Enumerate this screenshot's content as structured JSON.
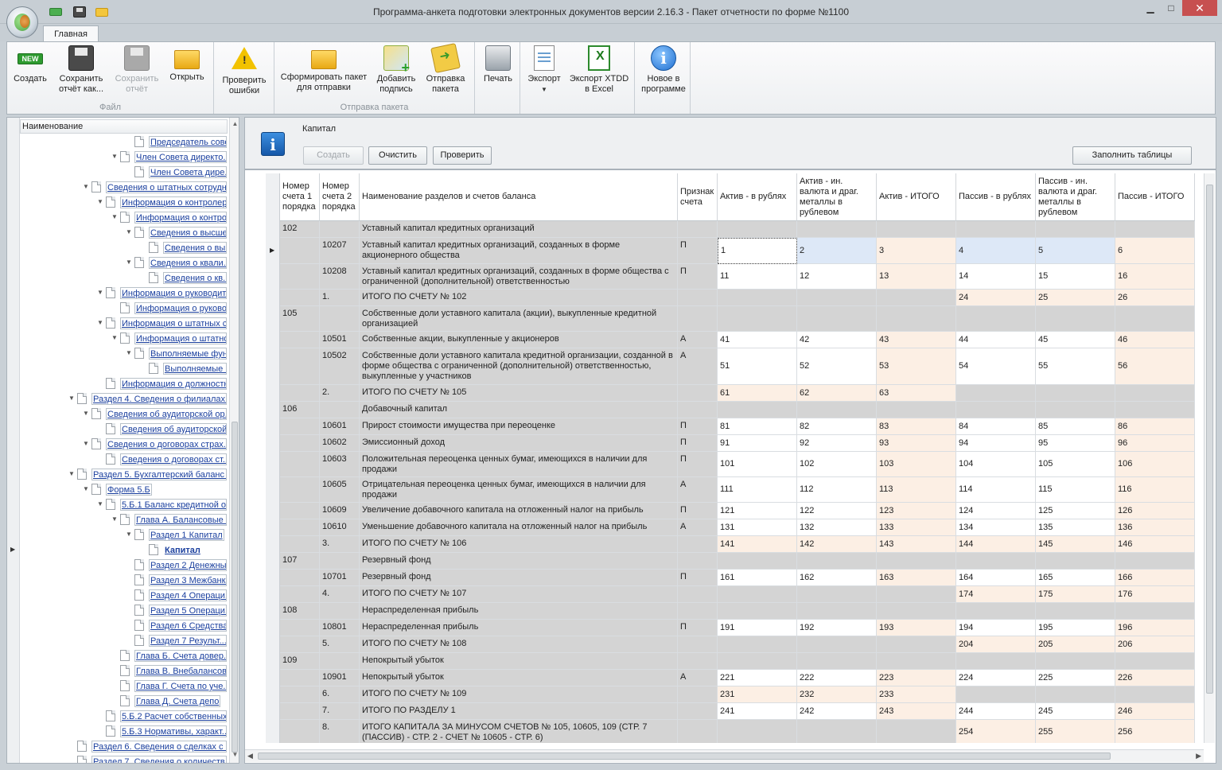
{
  "window": {
    "title": "Программа-анкета подготовки электронных документов версии 2.16.3 - Пакет отчетности по форме №1100",
    "min_icon": "minimize-icon",
    "max_icon": "maximize-icon",
    "close_icon": "close-icon"
  },
  "ribbon": {
    "tab": "Главная",
    "groups": [
      {
        "label": "Файл",
        "buttons": [
          {
            "id": "create",
            "label": "Создать",
            "icon": "new-icon"
          },
          {
            "id": "save_as",
            "label": "Сохранить\nотчёт как...",
            "icon": "floppy-icon"
          },
          {
            "id": "save",
            "label": "Сохранить\nотчёт",
            "icon": "floppy-icon",
            "disabled": true
          },
          {
            "id": "open",
            "label": "Открыть",
            "icon": "folder-icon"
          }
        ]
      },
      {
        "label": "",
        "buttons": [
          {
            "id": "check",
            "label": "Проверить\nошибки",
            "icon": "warning-icon"
          }
        ]
      },
      {
        "label": "Отправка пакета",
        "buttons": [
          {
            "id": "form_pkg",
            "label": "Сформировать пакет\nдля отправки",
            "icon": "folder-icon"
          },
          {
            "id": "sign",
            "label": "Добавить\nподпись",
            "icon": "add-signature-icon"
          },
          {
            "id": "send",
            "label": "Отправка\nпакета",
            "icon": "send-icon"
          }
        ]
      },
      {
        "label": "",
        "buttons": [
          {
            "id": "print",
            "label": "Печать",
            "icon": "printer-icon"
          }
        ]
      },
      {
        "label": "",
        "buttons": [
          {
            "id": "export",
            "label": "Экспорт",
            "icon": "export-icon"
          },
          {
            "id": "export_xtdd",
            "label": "Экспорт XTDD\nв Excel",
            "icon": "excel-icon"
          }
        ]
      },
      {
        "label": "",
        "buttons": [
          {
            "id": "whatsnew",
            "label": "Новое в\nпрограмме",
            "icon": "info-icon"
          }
        ]
      }
    ]
  },
  "tree": {
    "header": "Наименование",
    "items": [
      {
        "level": 7,
        "exp": "",
        "label": "Председатель совета ..."
      },
      {
        "level": 6,
        "exp": "▼",
        "label": "Член Совета директо..."
      },
      {
        "level": 7,
        "exp": "",
        "label": "Член Совета дире..."
      },
      {
        "level": 4,
        "exp": "▼",
        "label": "Сведения о штатных сотрудн..."
      },
      {
        "level": 5,
        "exp": "▼",
        "label": "Информация о контролер..."
      },
      {
        "level": 6,
        "exp": "▼",
        "label": "Информация о контро..."
      },
      {
        "level": 7,
        "exp": "▼",
        "label": "Сведения о высше..."
      },
      {
        "level": 8,
        "exp": "",
        "label": "Сведения о вы..."
      },
      {
        "level": 7,
        "exp": "▼",
        "label": "Сведения о квали..."
      },
      {
        "level": 8,
        "exp": "",
        "label": "Сведения о кв..."
      },
      {
        "level": 5,
        "exp": "▼",
        "label": "Информация о руководит..."
      },
      {
        "level": 6,
        "exp": "",
        "label": "Информация о руково..."
      },
      {
        "level": 5,
        "exp": "▼",
        "label": "Информация о штатных с..."
      },
      {
        "level": 6,
        "exp": "▼",
        "label": "Информация о штатно..."
      },
      {
        "level": 7,
        "exp": "▼",
        "label": "Выполняемые фун..."
      },
      {
        "level": 8,
        "exp": "",
        "label": "Выполняемые ..."
      },
      {
        "level": 5,
        "exp": "",
        "label": "Информация о должностн..."
      },
      {
        "level": 3,
        "exp": "▼",
        "label": "Раздел 4. Сведения о филиалах ..."
      },
      {
        "level": 4,
        "exp": "▼",
        "label": "Сведения об аудиторской ор..."
      },
      {
        "level": 5,
        "exp": "",
        "label": "Сведения об аудиторской..."
      },
      {
        "level": 4,
        "exp": "▼",
        "label": "Сведения о договорах страх..."
      },
      {
        "level": 5,
        "exp": "",
        "label": "Сведения о договорах ст..."
      },
      {
        "level": 3,
        "exp": "▼",
        "label": "Раздел 5. Бухгалтерский баланс ..."
      },
      {
        "level": 4,
        "exp": "▼",
        "label": "Форма 5.Б"
      },
      {
        "level": 5,
        "exp": "▼",
        "label": "5.Б.1 Баланс кредитной о..."
      },
      {
        "level": 6,
        "exp": "▼",
        "label": "Глава А. Балансовые ..."
      },
      {
        "level": 7,
        "exp": "▼",
        "label": "Раздел 1 Капитал"
      },
      {
        "level": 8,
        "exp": "",
        "label": "Капитал",
        "current": true
      },
      {
        "level": 7,
        "exp": "",
        "label": "Раздел 2 Денежны..."
      },
      {
        "level": 7,
        "exp": "",
        "label": "Раздел 3 Межбанк..."
      },
      {
        "level": 7,
        "exp": "",
        "label": "Раздел 4 Операци..."
      },
      {
        "level": 7,
        "exp": "",
        "label": "Раздел 5 Операци..."
      },
      {
        "level": 7,
        "exp": "",
        "label": "Раздел 6 Средства..."
      },
      {
        "level": 7,
        "exp": "",
        "label": "Раздел 7 Результ..."
      },
      {
        "level": 6,
        "exp": "",
        "label": "Глава Б. Счета довер..."
      },
      {
        "level": 6,
        "exp": "",
        "label": "Глава В. Внебалансов..."
      },
      {
        "level": 6,
        "exp": "",
        "label": "Глава Г. Счета по уче..."
      },
      {
        "level": 6,
        "exp": "",
        "label": "Глава Д. Счета депо"
      },
      {
        "level": 5,
        "exp": "",
        "label": "5.Б.2 Расчет собственных..."
      },
      {
        "level": 5,
        "exp": "",
        "label": "5.Б.3 Нормативы, характ..."
      },
      {
        "level": 3,
        "exp": "",
        "label": "Раздел 6. Сведения о сделках с ..."
      },
      {
        "level": 3,
        "exp": "",
        "label": "Раздел 7. Сведения о количеств..."
      }
    ]
  },
  "form": {
    "title": "Капитал",
    "icon": "info-icon",
    "buttons": {
      "create": "Создать",
      "clear": "Очистить",
      "check": "Проверить",
      "fill": "Заполнить таблицы"
    }
  },
  "grid": {
    "columns": [
      "Номер счета 1 порядка",
      "Номер счета 2 порядка",
      "Наименование разделов и счетов баланса",
      "Признак счета",
      "Актив - в рублях",
      "Актив - ин. валюта и драг. металлы в рублевом",
      "Актив - ИТОГО",
      "Пассив - в рублях",
      "Пассив - ин. валюта и драг. металлы в рублевом",
      "Пассив - ИТОГО"
    ],
    "rows": [
      {
        "h": 21,
        "type": "group",
        "c1": "102",
        "c2": "",
        "name": "Уставный капитал кредитных организаций",
        "sign": "",
        "v": [
          "",
          "",
          "",
          "",
          "",
          ""
        ]
      },
      {
        "h": 33,
        "type": "data",
        "c1": "",
        "c2": "10207",
        "name": "Уставный капитал кредитных организаций, созданных в форме акционерного общества",
        "sign": "П",
        "v": [
          "1",
          "2",
          "3",
          "4",
          "5",
          "6"
        ],
        "selected": true
      },
      {
        "h": 32,
        "type": "data",
        "c1": "",
        "c2": "10208",
        "name": "Уставный капитал кредитных организаций, созданных в форме общества с ограниченной (дополнительной) ответственностью",
        "sign": "П",
        "v": [
          "11",
          "12",
          "13",
          "14",
          "15",
          "16"
        ]
      },
      {
        "h": 21,
        "type": "total_p",
        "c1": "",
        "c2": "1.",
        "name": "ИТОГО ПО СЧЕТУ № 102",
        "sign": "",
        "v": [
          "",
          "",
          "",
          "24",
          "25",
          "26"
        ]
      },
      {
        "h": 32,
        "type": "group",
        "c1": "105",
        "c2": "",
        "name": "Собственные доли уставного капитала (акции), выкупленные кредитной организацией",
        "sign": "",
        "v": [
          "",
          "",
          "",
          "",
          "",
          ""
        ]
      },
      {
        "h": 21,
        "type": "data",
        "c1": "",
        "c2": "10501",
        "name": "Собственные акции, выкупленные у акционеров",
        "sign": "А",
        "v": [
          "41",
          "42",
          "43",
          "44",
          "45",
          "46"
        ]
      },
      {
        "h": 46,
        "type": "data",
        "c1": "",
        "c2": "10502",
        "name": "Собственные доли уставного капитала кредитной организации, созданной в форме общества с ограниченной (дополнительной) ответственностью, выкупленные у участников",
        "sign": "А",
        "v": [
          "51",
          "52",
          "53",
          "54",
          "55",
          "56"
        ]
      },
      {
        "h": 21,
        "type": "total_a",
        "c1": "",
        "c2": "2.",
        "name": "ИТОГО ПО СЧЕТУ № 105",
        "sign": "",
        "v": [
          "61",
          "62",
          "63",
          "",
          "",
          ""
        ]
      },
      {
        "h": 21,
        "type": "group",
        "c1": "106",
        "c2": "",
        "name": "Добавочный капитал",
        "sign": "",
        "v": [
          "",
          "",
          "",
          "",
          "",
          ""
        ]
      },
      {
        "h": 21,
        "type": "data",
        "c1": "",
        "c2": "10601",
        "name": "Прирост стоимости имущества при переоценке",
        "sign": "П",
        "v": [
          "81",
          "82",
          "83",
          "84",
          "85",
          "86"
        ]
      },
      {
        "h": 21,
        "type": "data",
        "c1": "",
        "c2": "10602",
        "name": "Эмиссионный доход",
        "sign": "П",
        "v": [
          "91",
          "92",
          "93",
          "94",
          "95",
          "96"
        ]
      },
      {
        "h": 32,
        "type": "data",
        "c1": "",
        "c2": "10603",
        "name": "Положительная переоценка ценных бумаг, имеющихся в наличии для продажи",
        "sign": "П",
        "v": [
          "101",
          "102",
          "103",
          "104",
          "105",
          "106"
        ]
      },
      {
        "h": 32,
        "type": "data",
        "c1": "",
        "c2": "10605",
        "name": "Отрицательная переоценка ценных бумаг, имеющихся в наличии для продажи",
        "sign": "А",
        "v": [
          "111",
          "112",
          "113",
          "114",
          "115",
          "116"
        ]
      },
      {
        "h": 21,
        "type": "data",
        "c1": "",
        "c2": "10609",
        "name": "Увеличение добавочного капитала на отложенный налог на прибыль",
        "sign": "П",
        "v": [
          "121",
          "122",
          "123",
          "124",
          "125",
          "126"
        ]
      },
      {
        "h": 21,
        "type": "data",
        "c1": "",
        "c2": "10610",
        "name": "Уменьшение добавочного капитала на отложенный налог на прибыль",
        "sign": "А",
        "v": [
          "131",
          "132",
          "133",
          "134",
          "135",
          "136"
        ]
      },
      {
        "h": 21,
        "type": "total_all",
        "c1": "",
        "c2": "3.",
        "name": "ИТОГО ПО СЧЕТУ № 106",
        "sign": "",
        "v": [
          "141",
          "142",
          "143",
          "144",
          "145",
          "146"
        ]
      },
      {
        "h": 21,
        "type": "group",
        "c1": "107",
        "c2": "",
        "name": "Резервный фонд",
        "sign": "",
        "v": [
          "",
          "",
          "",
          "",
          "",
          ""
        ]
      },
      {
        "h": 21,
        "type": "data",
        "c1": "",
        "c2": "10701",
        "name": "Резервный фонд",
        "sign": "П",
        "v": [
          "161",
          "162",
          "163",
          "164",
          "165",
          "166"
        ]
      },
      {
        "h": 21,
        "type": "total_p",
        "c1": "",
        "c2": "4.",
        "name": "ИТОГО ПО СЧЕТУ № 107",
        "sign": "",
        "v": [
          "",
          "",
          "",
          "174",
          "175",
          "176"
        ]
      },
      {
        "h": 21,
        "type": "group",
        "c1": "108",
        "c2": "",
        "name": "Нераспределенная прибыль",
        "sign": "",
        "v": [
          "",
          "",
          "",
          "",
          "",
          ""
        ]
      },
      {
        "h": 21,
        "type": "data",
        "c1": "",
        "c2": "10801",
        "name": "Нераспределенная прибыль",
        "sign": "П",
        "v": [
          "191",
          "192",
          "193",
          "194",
          "195",
          "196"
        ]
      },
      {
        "h": 21,
        "type": "total_p",
        "c1": "",
        "c2": "5.",
        "name": "ИТОГО ПО СЧЕТУ № 108",
        "sign": "",
        "v": [
          "",
          "",
          "",
          "204",
          "205",
          "206"
        ]
      },
      {
        "h": 21,
        "type": "group",
        "c1": "109",
        "c2": "",
        "name": "Непокрытый убыток",
        "sign": "",
        "v": [
          "",
          "",
          "",
          "",
          "",
          ""
        ]
      },
      {
        "h": 21,
        "type": "data",
        "c1": "",
        "c2": "10901",
        "name": "Непокрытый убыток",
        "sign": "А",
        "v": [
          "221",
          "222",
          "223",
          "224",
          "225",
          "226"
        ]
      },
      {
        "h": 21,
        "type": "total_a",
        "c1": "",
        "c2": "6.",
        "name": " ИТОГО ПО СЧЕТУ № 109",
        "sign": "",
        "v": [
          "231",
          "232",
          "233",
          "",
          "",
          ""
        ]
      },
      {
        "h": 21,
        "type": "data_total",
        "c1": "",
        "c2": "7.",
        "name": "ИТОГО ПО РАЗДЕЛУ 1",
        "sign": "",
        "v": [
          "241",
          "242",
          "243",
          "244",
          "245",
          "246"
        ]
      },
      {
        "h": 32,
        "type": "total_p",
        "c1": "",
        "c2": "8.",
        "name": "ИТОГО КАПИТАЛА ЗА МИНУСОМ СЧЕТОВ № 105, 10605, 109 (СТР. 7 (ПАССИВ) - СТР. 2 - СЧЕТ № 10605 - СТР. 6)",
        "sign": "",
        "v": [
          "",
          "",
          "",
          "254",
          "255",
          "256"
        ]
      }
    ]
  },
  "colors": {
    "group_row": "#d4d4d4",
    "calc_cell": "#fcefe4",
    "input_cell": "#ffffff",
    "selected_cell": "#dde8f7"
  }
}
